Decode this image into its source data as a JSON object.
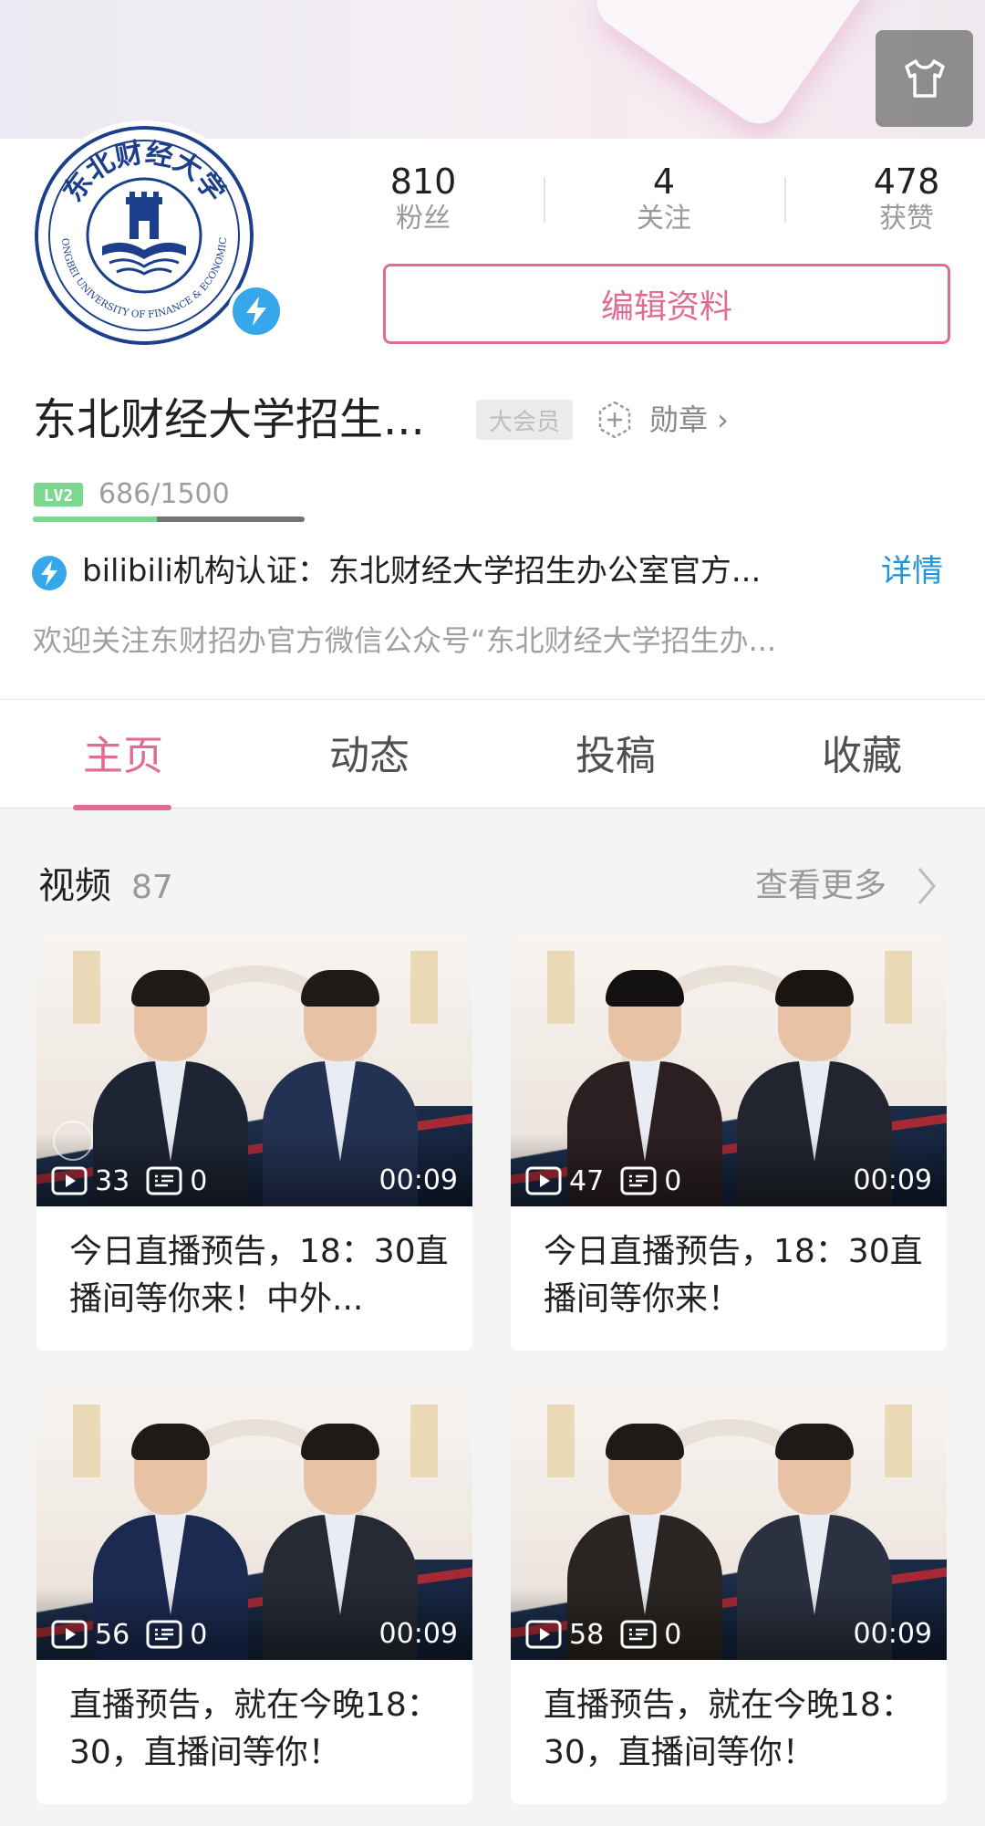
{
  "stats": [
    {
      "num": "810",
      "label": "粉丝"
    },
    {
      "num": "4",
      "label": "关注"
    },
    {
      "num": "478",
      "label": "获赞"
    }
  ],
  "edit_button": "编辑资料",
  "profile": {
    "name": "东北财经大学招生...",
    "vip_tag": "大会员",
    "medal": "勋章 ›",
    "level": "LV2",
    "exp_text": "686/1500",
    "exp_fraction": 0.457,
    "certification": "bilibili机构认证：东北财经大学招生办公室官方...",
    "cert_detail": "详情",
    "signature": "欢迎关注东财招办官方微信公众号“东北财经大学招生办..."
  },
  "logo_text": {
    "chinese": "东北财经大学",
    "english": "DONGBEI UNIVERSITY OF FINANCE & ECONOMICS"
  },
  "tabs": [
    {
      "label": "主页",
      "active": true
    },
    {
      "label": "动态",
      "active": false
    },
    {
      "label": "投稿",
      "active": false
    },
    {
      "label": "收藏",
      "active": false
    }
  ],
  "videos_section": {
    "title": "视频",
    "count": "87",
    "more": "查看更多"
  },
  "videos": [
    {
      "plays": "33",
      "comments": "0",
      "duration": "00:09",
      "title": "今日直播预告，18：30直播间等你来！中外..."
    },
    {
      "plays": "47",
      "comments": "0",
      "duration": "00:09",
      "title": "今日直播预告，18：30直播间等你来！"
    },
    {
      "plays": "56",
      "comments": "0",
      "duration": "00:09",
      "title": "直播预告，就在今晚18：30，直播间等你！"
    },
    {
      "plays": "58",
      "comments": "0",
      "duration": "00:09",
      "title": "直播预告，就在今晚18：30，直播间等你！"
    }
  ],
  "colors": {
    "accent_pink": "#e06c95",
    "link_blue": "#2094d8",
    "logo_navy": "#1b3f8a",
    "exp_green": "#7bd88f"
  },
  "icons": [
    "tshirt-icon",
    "bolt-icon",
    "medal-plus-icon",
    "play-icon",
    "danmaku-icon",
    "chevron-right-icon",
    "mic-icon"
  ]
}
